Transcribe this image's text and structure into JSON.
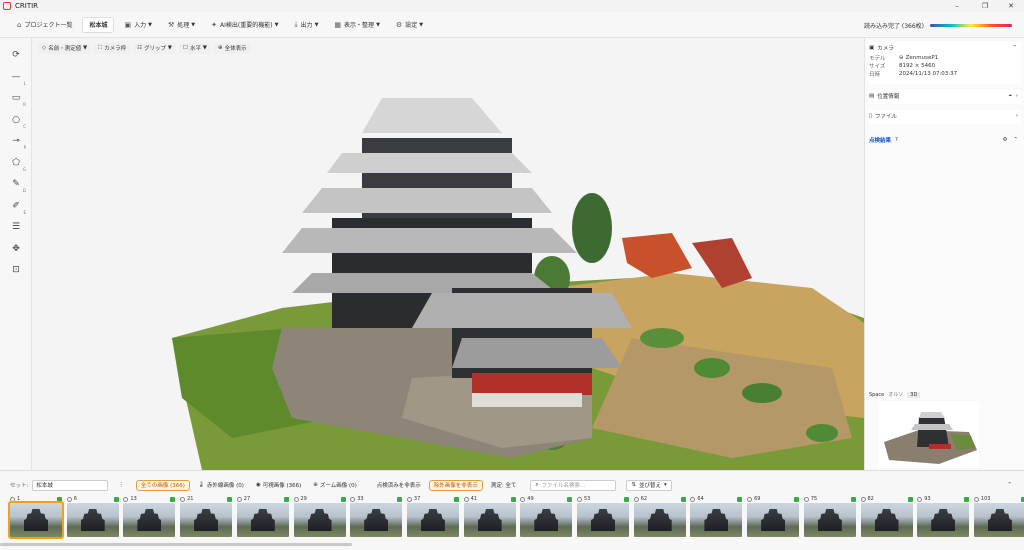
{
  "window": {
    "app_title": "CRITIR",
    "min": "–",
    "max": "❐",
    "close": "✕"
  },
  "toolbar": {
    "project_list": "プロジェクト一覧",
    "project_name": "松本城",
    "input": "入力",
    "process": "処理",
    "ai": "AI検出(重要的機能)",
    "output": "出力",
    "display": "表示・整理",
    "settings": "設定",
    "status": "読み込み完了 (366枚)",
    "progress": 1.0
  },
  "left_tools": [
    {
      "name": "rotate-view-tool",
      "glyph": "⟳",
      "key": ""
    },
    {
      "name": "line-tool",
      "glyph": "—",
      "key": "L"
    },
    {
      "name": "rect-tool",
      "glyph": "▭",
      "key": "R"
    },
    {
      "name": "circle-tool",
      "glyph": "○",
      "key": "C"
    },
    {
      "name": "point-tool",
      "glyph": "⊸",
      "key": "P"
    },
    {
      "name": "polygon-tool",
      "glyph": "⬠",
      "key": "G"
    },
    {
      "name": "pen-tool",
      "glyph": "✎",
      "key": "D"
    },
    {
      "name": "edit-tool",
      "glyph": "✐",
      "key": "E"
    },
    {
      "name": "adjust-tool",
      "glyph": "☰",
      "key": ""
    },
    {
      "name": "move-tool",
      "glyph": "✥",
      "key": ""
    },
    {
      "name": "focus-tool",
      "glyph": "⊡",
      "key": ""
    }
  ],
  "viewport": {
    "name_measure": "名前・測定値",
    "camera_frame": "カメラ枠",
    "grip": "グリップ",
    "horizontal": "水平",
    "show_all": "全体表示"
  },
  "camera": {
    "title": "カメラ",
    "model_k": "モデル",
    "model_v": "ZenmuseP1",
    "size_k": "サイズ",
    "size_v": "8192 × 5460",
    "date_k": "日時",
    "date_v": "2024/11/13 07:03:37"
  },
  "location": {
    "title": "位置情報"
  },
  "file": {
    "title": "ファイル"
  },
  "inspection": {
    "title": "点検結果"
  },
  "minimap": {
    "label": "Space",
    "ortho": "オルソ",
    "three_d": "3D"
  },
  "bottom": {
    "set_label": "セット:",
    "set_value": "松本城",
    "all_images": "全ての画像 (366)",
    "infrared": "赤外線画像 (0)",
    "visible": "可視画像 (366)",
    "zoom": "ズーム画像 (0)",
    "hide_done": "点検済みを非表示",
    "hide_excluded": "除外画像を非表示",
    "measure": "測定: 全て",
    "search_placeholder": "ファイル名検索...",
    "sort": "並び替え"
  },
  "thumbnails": [
    "1",
    "6",
    "13",
    "21",
    "27",
    "29",
    "33",
    "37",
    "41",
    "49",
    "53",
    "62",
    "64",
    "69",
    "75",
    "82",
    "93",
    "103"
  ]
}
